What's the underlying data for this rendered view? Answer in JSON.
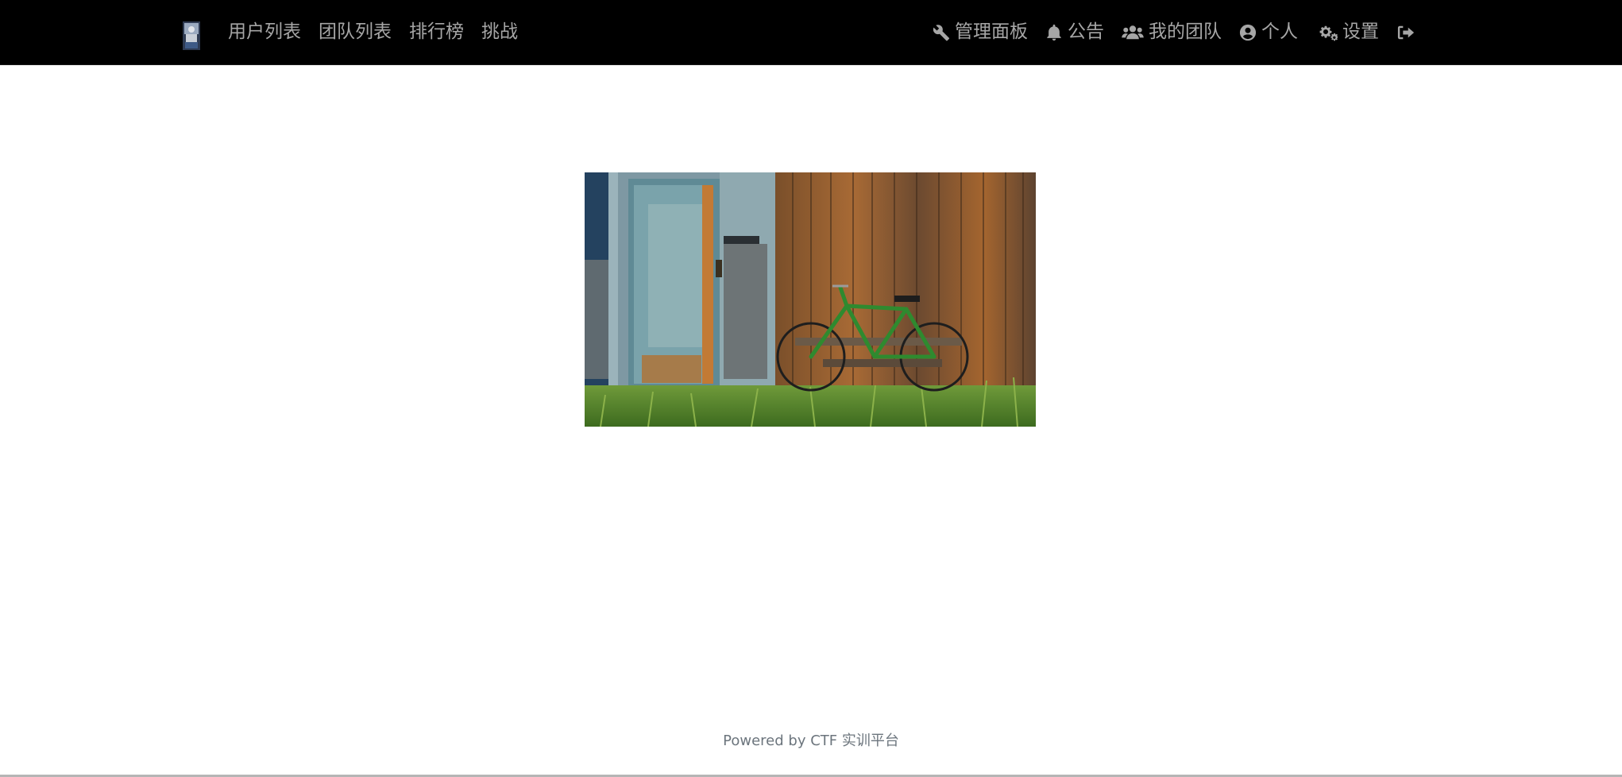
{
  "nav": {
    "left_items": [
      {
        "label": "用户列表"
      },
      {
        "label": "团队列表"
      },
      {
        "label": "排行榜"
      },
      {
        "label": "挑战"
      }
    ],
    "right_items": [
      {
        "icon": "wrench-icon",
        "label": "管理面板"
      },
      {
        "icon": "bell-icon",
        "label": "公告"
      },
      {
        "icon": "users-icon",
        "label": "我的团队"
      },
      {
        "icon": "user-circle-icon",
        "label": "个人"
      },
      {
        "icon": "gears-icon",
        "label": "设置"
      },
      {
        "icon": "sign-out-icon",
        "label": ""
      }
    ]
  },
  "footer": {
    "text": "Powered by CTF 实训平台"
  },
  "colors": {
    "navbar_bg": "#000000",
    "nav_text": "#a6a6a6",
    "page_bg": "#ffffff",
    "footer_text": "#6c757d"
  }
}
